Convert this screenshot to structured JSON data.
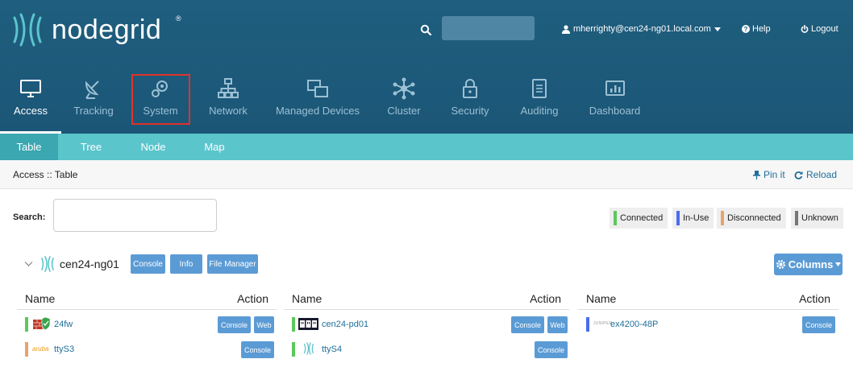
{
  "header": {
    "logo_text": "nodegrid",
    "logo_mark": "®",
    "user": "mherrighty@cen24-ng01.local.com",
    "help_label": "Help",
    "logout_label": "Logout"
  },
  "nav": {
    "items": [
      {
        "label": "Access",
        "icon": "monitor-icon"
      },
      {
        "label": "Tracking",
        "icon": "satellite-dish-icon"
      },
      {
        "label": "System",
        "icon": "gear-icon"
      },
      {
        "label": "Network",
        "icon": "network-icon"
      },
      {
        "label": "Managed Devices",
        "icon": "devices-icon"
      },
      {
        "label": "Cluster",
        "icon": "cluster-icon"
      },
      {
        "label": "Security",
        "icon": "lock-icon"
      },
      {
        "label": "Auditing",
        "icon": "notepad-icon"
      },
      {
        "label": "Dashboard",
        "icon": "dashboard-icon"
      }
    ]
  },
  "subnav": {
    "items": [
      "Table",
      "Tree",
      "Node",
      "Map"
    ]
  },
  "breadcrumb": {
    "text": "Access :: Table",
    "pin_label": "Pin it",
    "reload_label": "Reload"
  },
  "search": {
    "label": "Search:"
  },
  "legend": [
    {
      "label": "Connected",
      "color": "#5cc85c"
    },
    {
      "label": "In-Use",
      "color": "#4a6cf0"
    },
    {
      "label": "Disconnected",
      "color": "#e8a46a"
    },
    {
      "label": "Unknown",
      "color": "#777777"
    }
  ],
  "device": {
    "name": "cen24-ng01",
    "console_label": "Console",
    "info_label": "Info",
    "file_manager_label": "File Manager",
    "columns_label": "Columns"
  },
  "tables": {
    "name_header": "Name",
    "action_header": "Action",
    "rows": [
      {
        "name": "24fw",
        "status_color": "#5cc85c",
        "icon": "firewall-icon",
        "actions": [
          "Console",
          "Web"
        ]
      },
      {
        "name": "ttyS3",
        "status_color": "#e8a46a",
        "icon": "aruba-logo-icon",
        "icon_text": "aruba",
        "actions": [
          "Console"
        ]
      },
      {
        "name": "cen24-pd01",
        "status_color": "#5cc85c",
        "icon": "pdu-icon",
        "actions": [
          "Console",
          "Web"
        ]
      },
      {
        "name": "ttyS4",
        "status_color": "#5cc85c",
        "icon": "nodegrid-icon",
        "actions": [
          "Console"
        ]
      },
      {
        "name": "ex4200-48P",
        "status_color": "#4a6cf0",
        "icon": "juniper-logo-icon",
        "icon_text": "JUNIPER",
        "actions": [
          "Console"
        ]
      }
    ]
  }
}
